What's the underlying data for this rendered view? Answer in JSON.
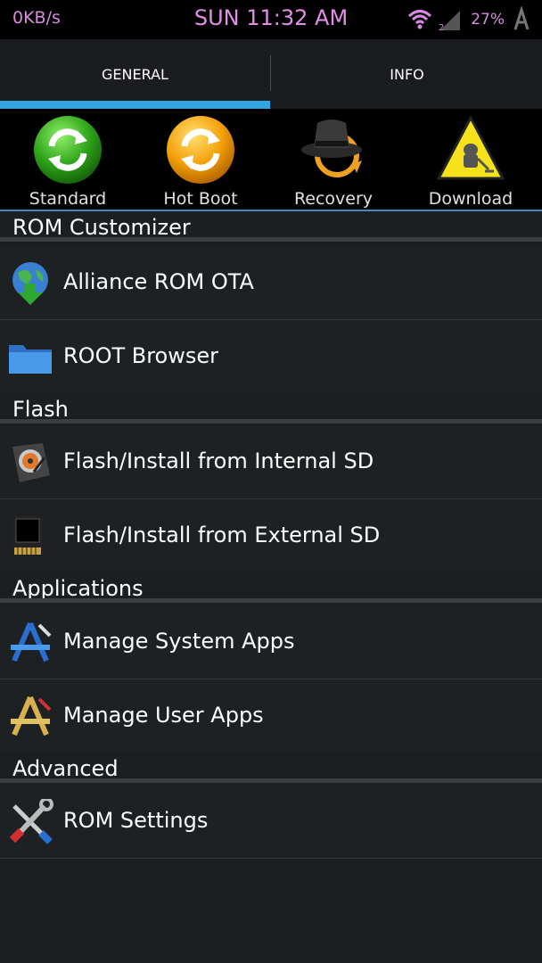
{
  "status_bar": {
    "net_speed": "0KB/s",
    "clock": "SUN 11:32 AM",
    "battery": "27%",
    "colors": {
      "text": "#d88be0"
    }
  },
  "tabs": [
    {
      "label": "GENERAL",
      "selected": true
    },
    {
      "label": "INFO",
      "selected": false
    }
  ],
  "reboot_options": [
    {
      "label": "Standard",
      "icon": "green-refresh-icon"
    },
    {
      "label": "Hot Boot",
      "icon": "orange-refresh-icon"
    },
    {
      "label": "Recovery",
      "icon": "clockworkmod-hat-icon"
    },
    {
      "label": "Download",
      "icon": "android-warning-icon"
    }
  ],
  "sections": [
    {
      "title": "ROM Customizer",
      "items": [
        {
          "label": "Alliance ROM OTA",
          "icon": "globe-download-icon"
        },
        {
          "label": "ROOT Browser",
          "icon": "folder-icon"
        }
      ]
    },
    {
      "title": "Flash",
      "items": [
        {
          "label": "Flash/Install from Internal SD",
          "icon": "hard-drive-icon"
        },
        {
          "label": "Flash/Install from External SD",
          "icon": "sd-card-icon"
        }
      ]
    },
    {
      "title": "Applications",
      "items": [
        {
          "label": "Manage System Apps",
          "icon": "app-tools-blue-icon"
        },
        {
          "label": "Manage User Apps",
          "icon": "app-tools-orange-icon"
        }
      ]
    },
    {
      "title": "Advanced",
      "items": [
        {
          "label": "ROM Settings",
          "icon": "wrench-screwdriver-icon"
        }
      ]
    }
  ],
  "colors": {
    "accent": "#33a5e0",
    "background": "#1c1f22"
  }
}
